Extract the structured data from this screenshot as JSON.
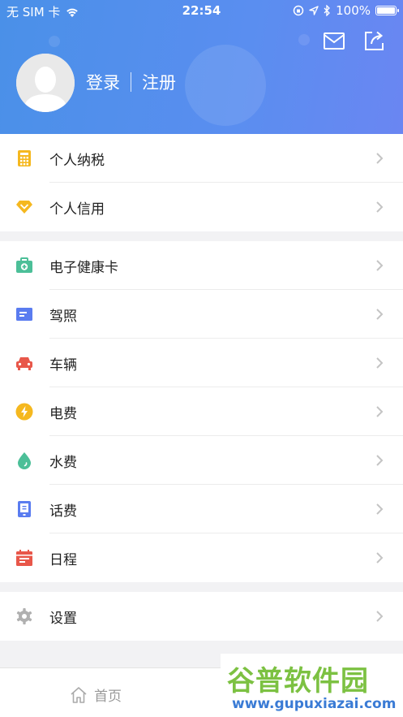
{
  "status_bar": {
    "carrier": "无 SIM 卡",
    "time": "22:54",
    "battery": "100%",
    "battery_level": 1.0,
    "icons": [
      "wifi-icon",
      "rotation-lock-icon",
      "location-arrow-icon",
      "bluetooth-icon",
      "battery-icon"
    ]
  },
  "header": {
    "login_label": "登录",
    "register_label": "注册",
    "icons": [
      "avatar",
      "message-icon",
      "share-icon"
    ]
  },
  "sections": [
    {
      "items": [
        {
          "label": "个人纳税",
          "icon": "calculator-icon",
          "color": "#f5b81f"
        },
        {
          "label": "个人信用",
          "icon": "diamond-icon",
          "color": "#f5b81f"
        }
      ]
    },
    {
      "items": [
        {
          "label": "电子健康卡",
          "icon": "medical-kit-icon",
          "color": "#4cbf98"
        },
        {
          "label": "驾照",
          "icon": "license-card-icon",
          "color": "#5a7cf0"
        },
        {
          "label": "车辆",
          "icon": "car-icon",
          "color": "#e8574a"
        },
        {
          "label": "电费",
          "icon": "lightning-icon",
          "color": "#f5b81f"
        },
        {
          "label": "水费",
          "icon": "water-drop-icon",
          "color": "#4cbf98"
        },
        {
          "label": "话费",
          "icon": "phone-bill-icon",
          "color": "#5a7cf0"
        },
        {
          "label": "日程",
          "icon": "calendar-icon",
          "color": "#e8574a"
        }
      ]
    },
    {
      "items": [
        {
          "label": "设置",
          "icon": "gear-icon",
          "color": "#b0b0b0"
        }
      ]
    }
  ],
  "tabbar": {
    "home_label": "首页"
  },
  "watermark": {
    "title": "谷普软件园",
    "url": "www.gupuxiazai.com"
  }
}
